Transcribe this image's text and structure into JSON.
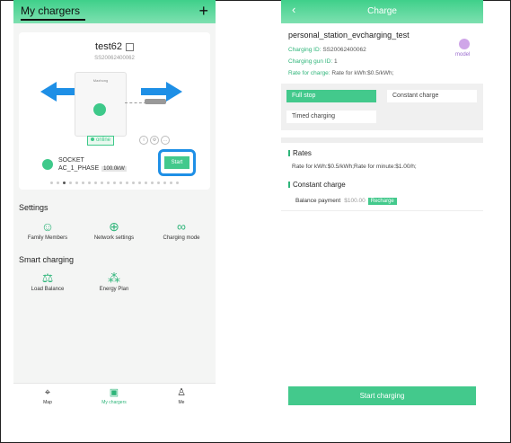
{
  "left": {
    "header": {
      "title": "My chargers",
      "add_icon": "plus-icon"
    },
    "card": {
      "device_name": "test62",
      "device_id": "SS20062400062",
      "brand_text": "Maxhong",
      "status": "online",
      "socket_type": "SOCKET",
      "socket_phase": "AC_1_PHASE",
      "power": "100.0kW",
      "start_label": "Start",
      "highlight_color": "#1e8fe6"
    },
    "settings": {
      "title": "Settings",
      "items": [
        {
          "label": "Family Members",
          "icon": "family-icon"
        },
        {
          "label": "Network settings",
          "icon": "network-icon"
        },
        {
          "label": "Charging mode",
          "icon": "charging-mode-icon"
        }
      ]
    },
    "smart": {
      "title": "Smart charging",
      "items": [
        {
          "label": "Load Balance",
          "icon": "load-balance-icon"
        },
        {
          "label": "Energy Plan",
          "icon": "energy-plan-icon"
        }
      ]
    },
    "tabbar": [
      {
        "label": "Map",
        "icon": "map-icon"
      },
      {
        "label": "My chargers",
        "icon": "chargers-icon",
        "active": true
      },
      {
        "label": "Me",
        "icon": "user-icon"
      }
    ]
  },
  "right": {
    "header": {
      "title": "Charge",
      "back_icon": "chevron-left-icon"
    },
    "station_name": "personal_station_evcharging_test",
    "charging_id_label": "Charging ID:",
    "charging_id": "SS20062400062",
    "gun_id_label": "Charging gun ID:",
    "gun_id": "1",
    "rate_label": "Rate for charge:",
    "rate_value": "Rate for kWh:$0.5/kWh;",
    "model_label": "model",
    "modes": [
      {
        "label": "Full stop",
        "active": true
      },
      {
        "label": "Constant charge",
        "active": false
      },
      {
        "label": "Timed charging",
        "active": false
      }
    ],
    "rates_title": "Rates",
    "rates_text": "Rate for kWh:$0.5/kWh;Rate for minute:$1.00/h;",
    "constant_title": "Constant charge",
    "balance_label": "Balance payment",
    "balance_amount": "$100.00",
    "recharge_label": "Recharge",
    "start_charging_label": "Start charging",
    "accent_color": "#43c98c"
  }
}
